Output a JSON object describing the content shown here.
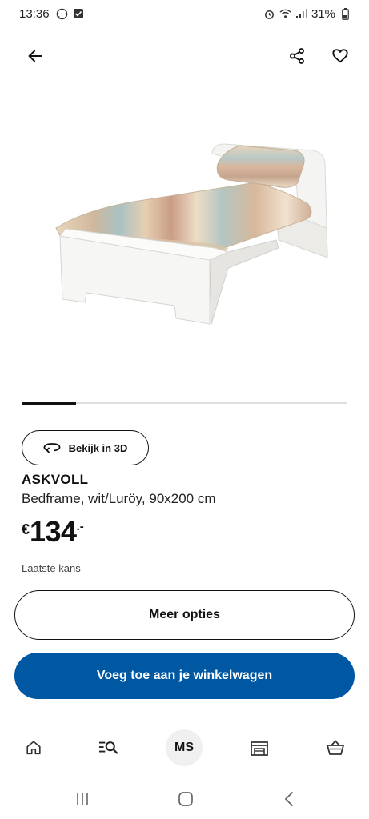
{
  "status_bar": {
    "time": "13:36",
    "battery": "31%"
  },
  "header": {
    "back_icon": "arrow-left-icon",
    "share_icon": "share-icon",
    "favorite_icon": "heart-icon"
  },
  "product": {
    "image_icon": "bed-frame-image",
    "carousel": {
      "active_index": 0,
      "total": 6
    },
    "view_3d_label": "Bekijk in 3D",
    "name": "ASKVOLL",
    "description": "Bedframe, wit/Luröy, 90x200 cm",
    "price": {
      "currency": "€",
      "amount": "134",
      "suffix": ".-"
    },
    "availability": "Laatste kans",
    "more_options_label": "Meer opties",
    "add_to_cart_label": "Voeg toe aan je winkelwagen"
  },
  "bottom_nav": {
    "items": [
      {
        "icon": "home-icon"
      },
      {
        "icon": "search-list-icon"
      },
      {
        "label": "MS"
      },
      {
        "icon": "store-icon"
      },
      {
        "icon": "basket-icon"
      }
    ]
  },
  "colors": {
    "primary": "#0058a3",
    "text": "#111111",
    "muted": "#444444",
    "track": "#dfdfdf"
  }
}
